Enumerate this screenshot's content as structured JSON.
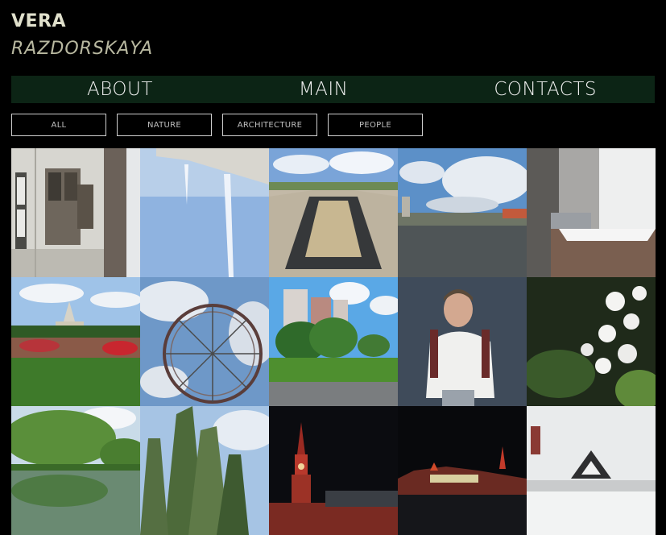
{
  "header": {
    "first_name": "VERA",
    "last_name": "RAZDORSKAYA"
  },
  "nav": {
    "items": [
      "ABOUT",
      "MAIN",
      "CONTACTS"
    ]
  },
  "filters": {
    "items": [
      "ALL",
      "NATURE",
      "ARCHITECTURE",
      "PEOPLE"
    ]
  },
  "colors": {
    "background": "#000000",
    "nav_bar": "#0c2415",
    "name_text": "#e0e0cc"
  },
  "gallery": {
    "photos": [
      "building-facade-photo",
      "contrails-sky-photo",
      "stadium-photo",
      "river-city-photo",
      "snowy-balcony-photo",
      "exhibition-park-photo",
      "ferris-wheel-photo",
      "park-apartments-photo",
      "man-portrait-photo",
      "blossom-photo",
      "river-trees-photo",
      "poplar-trees-photo",
      "kremlin-tower-night-photo",
      "red-square-night-photo",
      "snowy-roof-photo"
    ]
  }
}
